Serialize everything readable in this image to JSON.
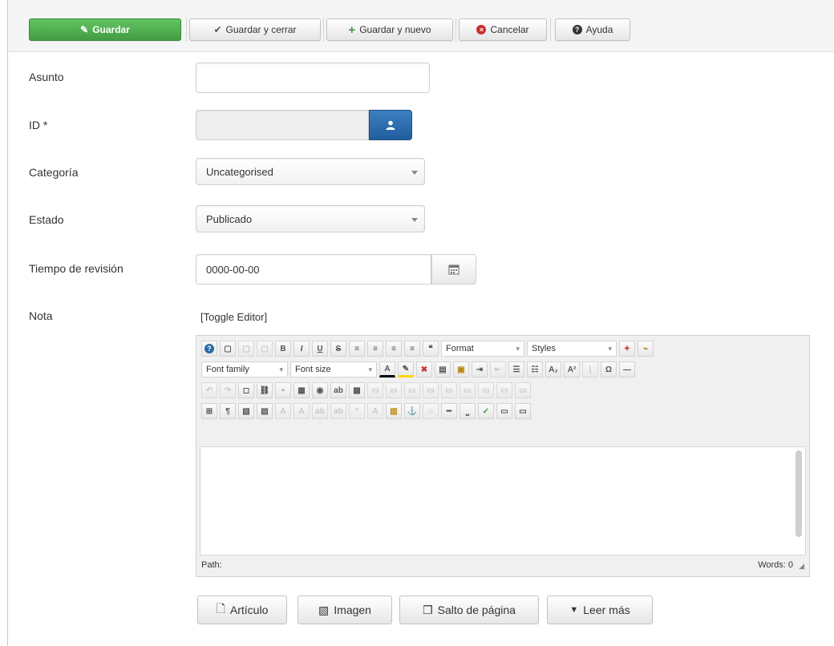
{
  "toolbar": {
    "save_label": "Guardar",
    "save_close_label": "Guardar y cerrar",
    "save_new_label": "Guardar y nuevo",
    "cancel_label": "Cancelar",
    "help_label": "Ayuda"
  },
  "form": {
    "subject": {
      "label": "Asunto",
      "value": ""
    },
    "id": {
      "label": "ID *",
      "value": ""
    },
    "category": {
      "label": "Categoría",
      "value": "Uncategorised"
    },
    "state": {
      "label": "Estado",
      "value": "Publicado"
    },
    "review_time": {
      "label": "Tiempo de revisión",
      "value": "0000-00-00"
    },
    "note": {
      "label": "Nota"
    }
  },
  "editor": {
    "toggle_label": "[Toggle Editor]",
    "format_label": "Format",
    "styles_label": "Styles",
    "font_family_label": "Font family",
    "font_size_label": "Font size",
    "path_label": "Path:",
    "words_label": "Words: 0"
  },
  "bottom_buttons": {
    "article": "Artículo",
    "image": "Imagen",
    "page_break": "Salto de página",
    "read_more": "Leer más"
  },
  "colors": {
    "save_green": "#51a351",
    "user_button_blue": "#2a6aa8",
    "cancel_red": "#c9302c"
  }
}
